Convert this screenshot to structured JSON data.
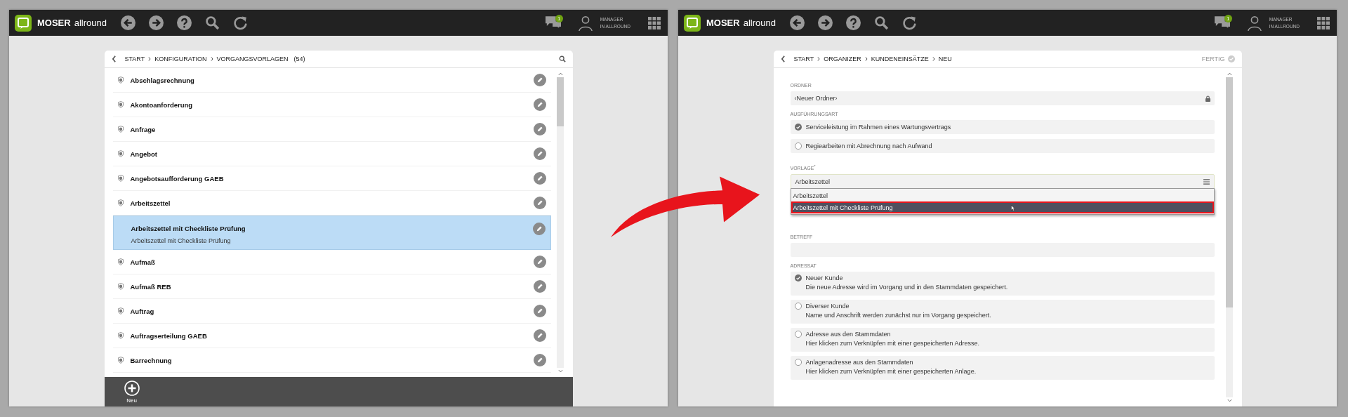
{
  "screens": [
    {
      "kind": "list",
      "brand": {
        "bold": "MOSER",
        "light": "allround"
      },
      "notification_count": "1",
      "user": {
        "line1": "MANAGER",
        "line2": "IN ALLROUND"
      },
      "breadcrumb": [
        "START",
        "KONFIGURATION",
        "VORGANGSVORLAGEN"
      ],
      "count": "(54)",
      "rows": [
        {
          "title": "Abschlagsrechnung",
          "selected": false
        },
        {
          "title": "Akontoanforderung",
          "selected": false
        },
        {
          "title": "Anfrage",
          "selected": false
        },
        {
          "title": "Angebot",
          "selected": false
        },
        {
          "title": "Angebotsaufforderung GAEB",
          "selected": false
        },
        {
          "title": "Arbeitszettel",
          "selected": false
        },
        {
          "title": "Arbeitszettel mit Checkliste Prüfung",
          "subtitle": "Arbeitszettel mit Checkliste Prüfung",
          "selected": true
        },
        {
          "title": "Aufmaß",
          "selected": false
        },
        {
          "title": "Aufmaß REB",
          "selected": false
        },
        {
          "title": "Auftrag",
          "selected": false
        },
        {
          "title": "Auftragserteilung GAEB",
          "selected": false
        },
        {
          "title": "Barrechnung",
          "selected": false
        }
      ],
      "toolbar": [
        {
          "label": "Neu"
        }
      ]
    },
    {
      "kind": "form",
      "brand": {
        "bold": "MOSER",
        "light": "allround"
      },
      "notification_count": "1",
      "user": {
        "line1": "MANAGER",
        "line2": "IN ALLROUND"
      },
      "breadcrumb": [
        "START",
        "ORGANIZER",
        "KUNDENEINSÄTZE",
        "NEU"
      ],
      "action": "FERTIG",
      "fields": [
        {
          "kind": "locked",
          "label": "ORDNER",
          "value": "‹Neuer Ordner›"
        },
        {
          "kind": "radio",
          "label": "AUSFÜHRUNGSART",
          "options": [
            {
              "title": "Serviceleistung im Rahmen eines Wartungsvertrags",
              "selected": true
            },
            {
              "title": "Regiearbeiten mit Abrechnung nach Aufwand",
              "selected": false
            }
          ]
        },
        {
          "kind": "select",
          "label": "VORLAGE$^{*}$",
          "value": "Arbeitszettel",
          "options": [
            {
              "label": "Arbeitszettel",
              "highlighted": false
            },
            {
              "label": "Arbeitszettel mit Checkliste Prüfung",
              "highlighted": true
            }
          ]
        },
        {
          "kind": "text",
          "label": "BETREFF"
        },
        {
          "kind": "radio",
          "label": "ADRESSAT",
          "options": [
            {
              "title": "Neuer Kunde",
              "description": "Die neue Adresse wird im Vorgang und in den Stammdaten gespeichert.",
              "selected": true
            },
            {
              "title": "Diverser Kunde",
              "description": "Name und Anschrift werden zunächst nur im Vorgang gespeichert.",
              "selected": false
            },
            {
              "title": "Adresse aus den Stammdaten",
              "description": "Hier klicken zum Verknüpfen mit einer gespeicherten Adresse.",
              "selected": false
            },
            {
              "title": "Anlagenadresse aus den Stammdaten",
              "description": "Hier klicken zum Verknüpfen mit einer gespeicherten Anlage.",
              "selected": false
            }
          ]
        }
      ]
    }
  ]
}
